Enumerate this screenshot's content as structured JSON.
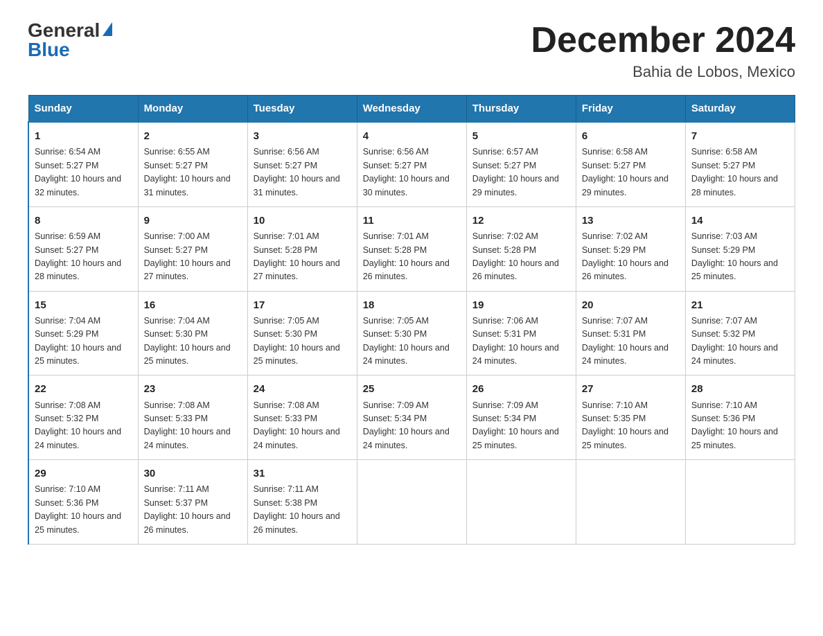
{
  "logo": {
    "general": "General",
    "blue": "Blue"
  },
  "header": {
    "month": "December 2024",
    "location": "Bahia de Lobos, Mexico"
  },
  "weekdays": [
    "Sunday",
    "Monday",
    "Tuesday",
    "Wednesday",
    "Thursday",
    "Friday",
    "Saturday"
  ],
  "weeks": [
    [
      {
        "day": "1",
        "sunrise": "6:54 AM",
        "sunset": "5:27 PM",
        "daylight": "10 hours and 32 minutes."
      },
      {
        "day": "2",
        "sunrise": "6:55 AM",
        "sunset": "5:27 PM",
        "daylight": "10 hours and 31 minutes."
      },
      {
        "day": "3",
        "sunrise": "6:56 AM",
        "sunset": "5:27 PM",
        "daylight": "10 hours and 31 minutes."
      },
      {
        "day": "4",
        "sunrise": "6:56 AM",
        "sunset": "5:27 PM",
        "daylight": "10 hours and 30 minutes."
      },
      {
        "day": "5",
        "sunrise": "6:57 AM",
        "sunset": "5:27 PM",
        "daylight": "10 hours and 29 minutes."
      },
      {
        "day": "6",
        "sunrise": "6:58 AM",
        "sunset": "5:27 PM",
        "daylight": "10 hours and 29 minutes."
      },
      {
        "day": "7",
        "sunrise": "6:58 AM",
        "sunset": "5:27 PM",
        "daylight": "10 hours and 28 minutes."
      }
    ],
    [
      {
        "day": "8",
        "sunrise": "6:59 AM",
        "sunset": "5:27 PM",
        "daylight": "10 hours and 28 minutes."
      },
      {
        "day": "9",
        "sunrise": "7:00 AM",
        "sunset": "5:27 PM",
        "daylight": "10 hours and 27 minutes."
      },
      {
        "day": "10",
        "sunrise": "7:01 AM",
        "sunset": "5:28 PM",
        "daylight": "10 hours and 27 minutes."
      },
      {
        "day": "11",
        "sunrise": "7:01 AM",
        "sunset": "5:28 PM",
        "daylight": "10 hours and 26 minutes."
      },
      {
        "day": "12",
        "sunrise": "7:02 AM",
        "sunset": "5:28 PM",
        "daylight": "10 hours and 26 minutes."
      },
      {
        "day": "13",
        "sunrise": "7:02 AM",
        "sunset": "5:29 PM",
        "daylight": "10 hours and 26 minutes."
      },
      {
        "day": "14",
        "sunrise": "7:03 AM",
        "sunset": "5:29 PM",
        "daylight": "10 hours and 25 minutes."
      }
    ],
    [
      {
        "day": "15",
        "sunrise": "7:04 AM",
        "sunset": "5:29 PM",
        "daylight": "10 hours and 25 minutes."
      },
      {
        "day": "16",
        "sunrise": "7:04 AM",
        "sunset": "5:30 PM",
        "daylight": "10 hours and 25 minutes."
      },
      {
        "day": "17",
        "sunrise": "7:05 AM",
        "sunset": "5:30 PM",
        "daylight": "10 hours and 25 minutes."
      },
      {
        "day": "18",
        "sunrise": "7:05 AM",
        "sunset": "5:30 PM",
        "daylight": "10 hours and 24 minutes."
      },
      {
        "day": "19",
        "sunrise": "7:06 AM",
        "sunset": "5:31 PM",
        "daylight": "10 hours and 24 minutes."
      },
      {
        "day": "20",
        "sunrise": "7:07 AM",
        "sunset": "5:31 PM",
        "daylight": "10 hours and 24 minutes."
      },
      {
        "day": "21",
        "sunrise": "7:07 AM",
        "sunset": "5:32 PM",
        "daylight": "10 hours and 24 minutes."
      }
    ],
    [
      {
        "day": "22",
        "sunrise": "7:08 AM",
        "sunset": "5:32 PM",
        "daylight": "10 hours and 24 minutes."
      },
      {
        "day": "23",
        "sunrise": "7:08 AM",
        "sunset": "5:33 PM",
        "daylight": "10 hours and 24 minutes."
      },
      {
        "day": "24",
        "sunrise": "7:08 AM",
        "sunset": "5:33 PM",
        "daylight": "10 hours and 24 minutes."
      },
      {
        "day": "25",
        "sunrise": "7:09 AM",
        "sunset": "5:34 PM",
        "daylight": "10 hours and 24 minutes."
      },
      {
        "day": "26",
        "sunrise": "7:09 AM",
        "sunset": "5:34 PM",
        "daylight": "10 hours and 25 minutes."
      },
      {
        "day": "27",
        "sunrise": "7:10 AM",
        "sunset": "5:35 PM",
        "daylight": "10 hours and 25 minutes."
      },
      {
        "day": "28",
        "sunrise": "7:10 AM",
        "sunset": "5:36 PM",
        "daylight": "10 hours and 25 minutes."
      }
    ],
    [
      {
        "day": "29",
        "sunrise": "7:10 AM",
        "sunset": "5:36 PM",
        "daylight": "10 hours and 25 minutes."
      },
      {
        "day": "30",
        "sunrise": "7:11 AM",
        "sunset": "5:37 PM",
        "daylight": "10 hours and 26 minutes."
      },
      {
        "day": "31",
        "sunrise": "7:11 AM",
        "sunset": "5:38 PM",
        "daylight": "10 hours and 26 minutes."
      },
      null,
      null,
      null,
      null
    ]
  ]
}
